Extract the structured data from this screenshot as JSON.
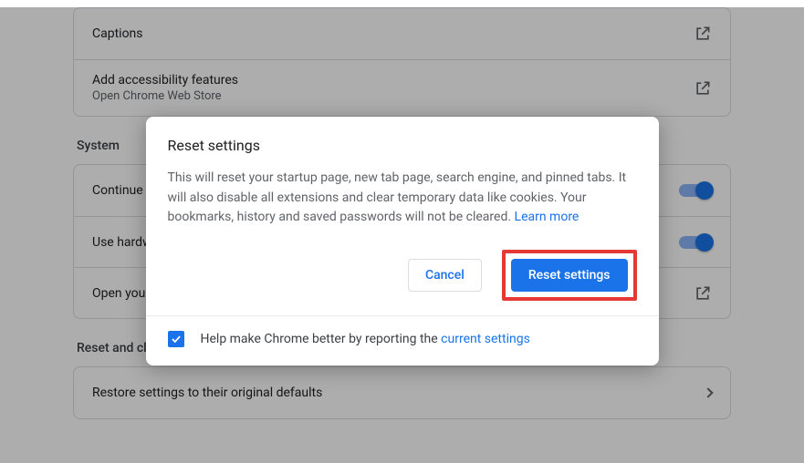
{
  "accessibility": {
    "captions": "Captions",
    "addFeatures": "Add accessibility features",
    "webStore": "Open Chrome Web Store"
  },
  "system": {
    "heading": "System",
    "continueBg": "Continue running background apps when Google Chrome is closed",
    "hwAccel": "Use hardware acceleration when available",
    "openProxy": "Open your computer's proxy settings"
  },
  "reset": {
    "heading": "Reset and clean up",
    "restore": "Restore settings to their original defaults"
  },
  "dialog": {
    "title": "Reset settings",
    "body": "This will reset your startup page, new tab page, search engine, and pinned tabs. It will also disable all extensions and clear temporary data like cookies. Your bookmarks, history and saved passwords will not be cleared. ",
    "learnMore": "Learn more",
    "cancel": "Cancel",
    "confirm": "Reset settings",
    "footerPre": "Help make Chrome better by reporting the ",
    "footerLink": "current settings"
  }
}
